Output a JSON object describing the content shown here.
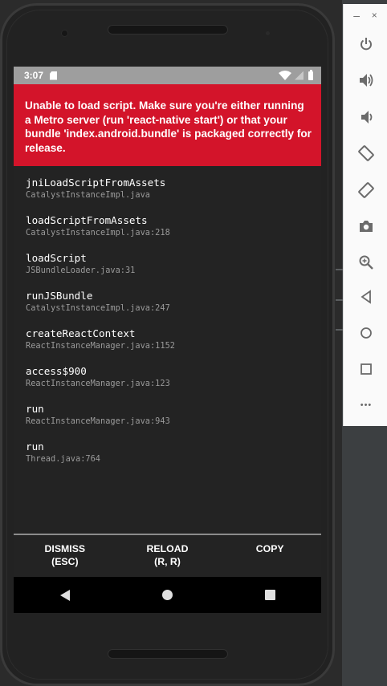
{
  "status_bar": {
    "time": "3:07"
  },
  "error": {
    "message": "Unable to load script. Make sure you're either running a Metro server (run 'react-native start') or that your bundle 'index.android.bundle' is packaged correctly for release."
  },
  "stack": [
    {
      "method": "jniLoadScriptFromAssets",
      "file": "CatalystInstanceImpl.java"
    },
    {
      "method": "loadScriptFromAssets",
      "file": "CatalystInstanceImpl.java:218"
    },
    {
      "method": "loadScript",
      "file": "JSBundleLoader.java:31"
    },
    {
      "method": "runJSBundle",
      "file": "CatalystInstanceImpl.java:247"
    },
    {
      "method": "createReactContext",
      "file": "ReactInstanceManager.java:1152"
    },
    {
      "method": "access$900",
      "file": "ReactInstanceManager.java:123"
    },
    {
      "method": "run",
      "file": "ReactInstanceManager.java:943"
    },
    {
      "method": "run",
      "file": "Thread.java:764"
    }
  ],
  "actions": {
    "dismiss": {
      "line1": "DISMISS",
      "line2": "(ESC)"
    },
    "reload": {
      "line1": "RELOAD",
      "line2": "(R, R)"
    },
    "copy": {
      "line1": "COPY",
      "line2": ""
    }
  },
  "toolbar": {
    "minimize_glyph": "–",
    "close_glyph": "×",
    "icons": [
      "power-icon",
      "volume-up-icon",
      "volume-down-icon",
      "rotate-left-icon",
      "rotate-right-icon",
      "camera-icon",
      "zoom-icon",
      "back-icon",
      "home-icon",
      "overview-icon",
      "more-icon"
    ],
    "more_glyph": "•••"
  },
  "colors": {
    "error_red": "#d3142a",
    "screen_bg": "#232323",
    "status_bar": "#9e9e9e",
    "toolbar_icon": "#6b6b6b"
  }
}
